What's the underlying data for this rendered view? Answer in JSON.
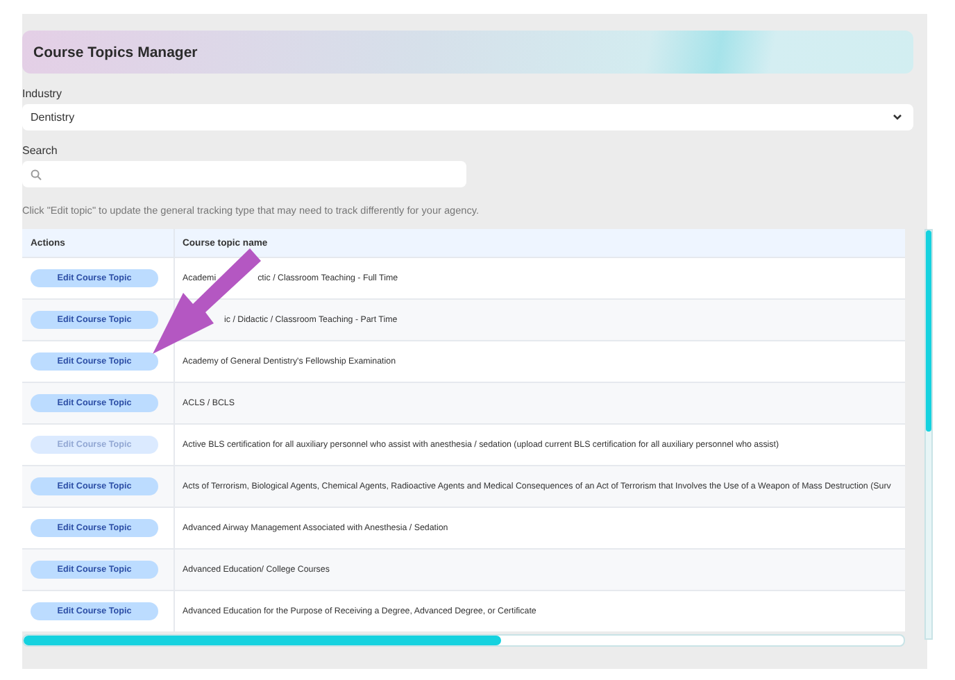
{
  "header": {
    "title": "Course Topics Manager"
  },
  "industry": {
    "label": "Industry",
    "value": "Dentistry"
  },
  "search": {
    "label": "Search"
  },
  "hint": "Click \"Edit topic\" to update the general tracking type that may need to track differently for your agency.",
  "table": {
    "columns": [
      "Actions",
      "Course topic name"
    ],
    "rows": [
      {
        "action": "Edit Course Topic",
        "disabled": false,
        "kind": "covered",
        "name_parts": [
          "Academi",
          "ctic / Classroom Teaching - Full Time"
        ]
      },
      {
        "action": "Edit Course Topic",
        "disabled": false,
        "kind": "covered",
        "name_parts": [
          "ic / Didactic / Classroom Teaching - Part Time"
        ]
      },
      {
        "action": "Edit Course Topic",
        "disabled": false,
        "name": "Academy of General Dentistry's Fellowship Examination"
      },
      {
        "action": "Edit Course Topic",
        "disabled": false,
        "name": "ACLS / BCLS"
      },
      {
        "action": "Edit Course Topic",
        "disabled": true,
        "name": "Active BLS certification for all auxiliary personnel who assist with anesthesia / sedation (upload current BLS certification for all auxiliary personnel who assist)"
      },
      {
        "action": "Edit Course Topic",
        "disabled": false,
        "name": "Acts of Terrorism, Biological Agents, Chemical Agents, Radioactive Agents and Medical Consequences of an Act of Terrorism that Involves the Use of a Weapon of Mass Destruction (Surv"
      },
      {
        "action": "Edit Course Topic",
        "disabled": false,
        "name": "Advanced Airway Management Associated with Anesthesia / Sedation"
      },
      {
        "action": "Edit Course Topic",
        "disabled": false,
        "name": "Advanced Education/ College Courses"
      },
      {
        "action": "Edit Course Topic",
        "disabled": false,
        "name": "Advanced Education for the Purpose of Receiving a Degree, Advanced Degree, or Certificate"
      }
    ]
  }
}
